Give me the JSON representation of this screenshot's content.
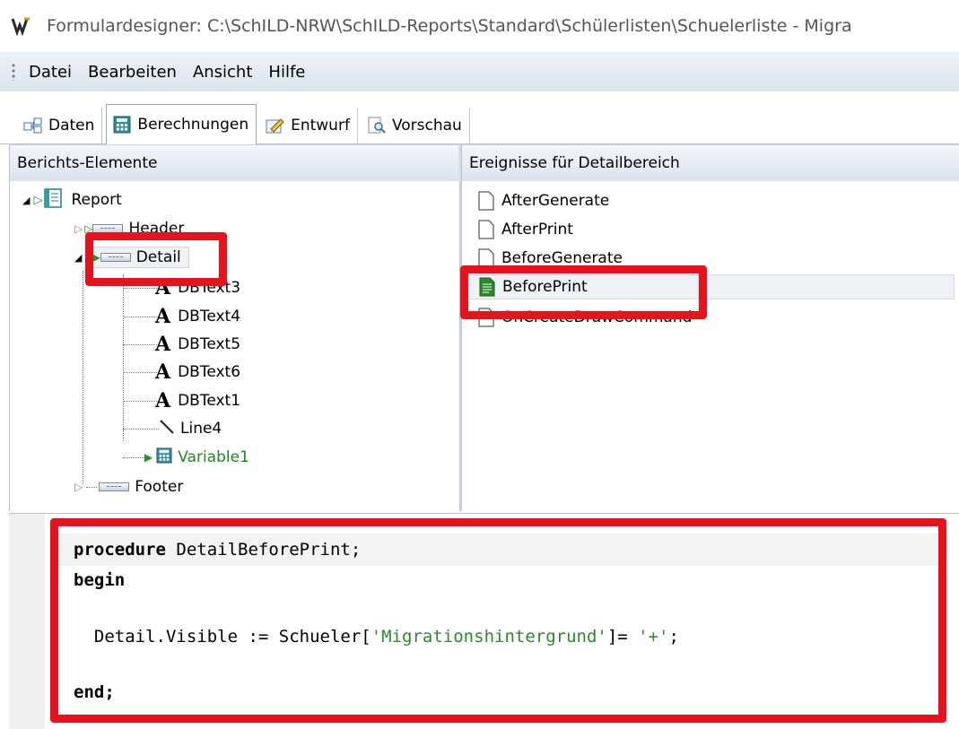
{
  "window": {
    "title": "Formulardesigner: C:\\SchILD-NRW\\SchILD-Reports\\Standard\\Schülerlisten\\Schuelerliste - Migra",
    "icon": "app-logo-icon"
  },
  "menu": {
    "items": [
      "Datei",
      "Bearbeiten",
      "Ansicht",
      "Hilfe"
    ]
  },
  "tabs": [
    {
      "label": "Daten",
      "icon": "data-tables-icon"
    },
    {
      "label": "Berechnungen",
      "icon": "calculator-icon",
      "active": true
    },
    {
      "label": "Entwurf",
      "icon": "design-pencil-icon"
    },
    {
      "label": "Vorschau",
      "icon": "preview-magnifier-icon"
    }
  ],
  "left_pane": {
    "title": "Berichts-Elemente",
    "tree": [
      {
        "label": "Report",
        "icon": "report-icon"
      },
      {
        "label": "Header",
        "icon": "band-icon"
      },
      {
        "label": "Detail",
        "icon": "band-icon",
        "selected": true
      },
      {
        "label": "DBText3",
        "icon": "dbtext-icon"
      },
      {
        "label": "DBText4",
        "icon": "dbtext-icon"
      },
      {
        "label": "DBText5",
        "icon": "dbtext-icon"
      },
      {
        "label": "DBText6",
        "icon": "dbtext-icon"
      },
      {
        "label": "DBText1",
        "icon": "dbtext-icon"
      },
      {
        "label": "Line4",
        "icon": "line-icon"
      },
      {
        "label": "Variable1",
        "icon": "calculator-icon",
        "has_code": true
      },
      {
        "label": "Footer",
        "icon": "band-icon"
      }
    ]
  },
  "right_pane": {
    "title": "Ereignisse für Detailbereich",
    "events": [
      {
        "label": "AfterGenerate",
        "icon": "document-icon"
      },
      {
        "label": "AfterPrint",
        "icon": "document-icon"
      },
      {
        "label": "BeforeGenerate",
        "icon": "document-icon"
      },
      {
        "label": "BeforePrint",
        "icon": "document-code-icon",
        "selected": true
      },
      {
        "label": "OnCreateDrawCommand",
        "icon": "document-icon"
      }
    ]
  },
  "code": {
    "line1_kw": "procedure",
    "line1_rest": " DetailBeforePrint;",
    "line2": "begin",
    "line3_a": "  Detail.Visible := Schueler[",
    "line3_str1": "'Migrationshintergrund'",
    "line3_b": "]= ",
    "line3_str2": "'+'",
    "line3_c": ";",
    "line4": "end;"
  },
  "colors": {
    "highlight": "#e8121c",
    "string": "#2b8a2b",
    "green_node": "#1e8a1e"
  }
}
